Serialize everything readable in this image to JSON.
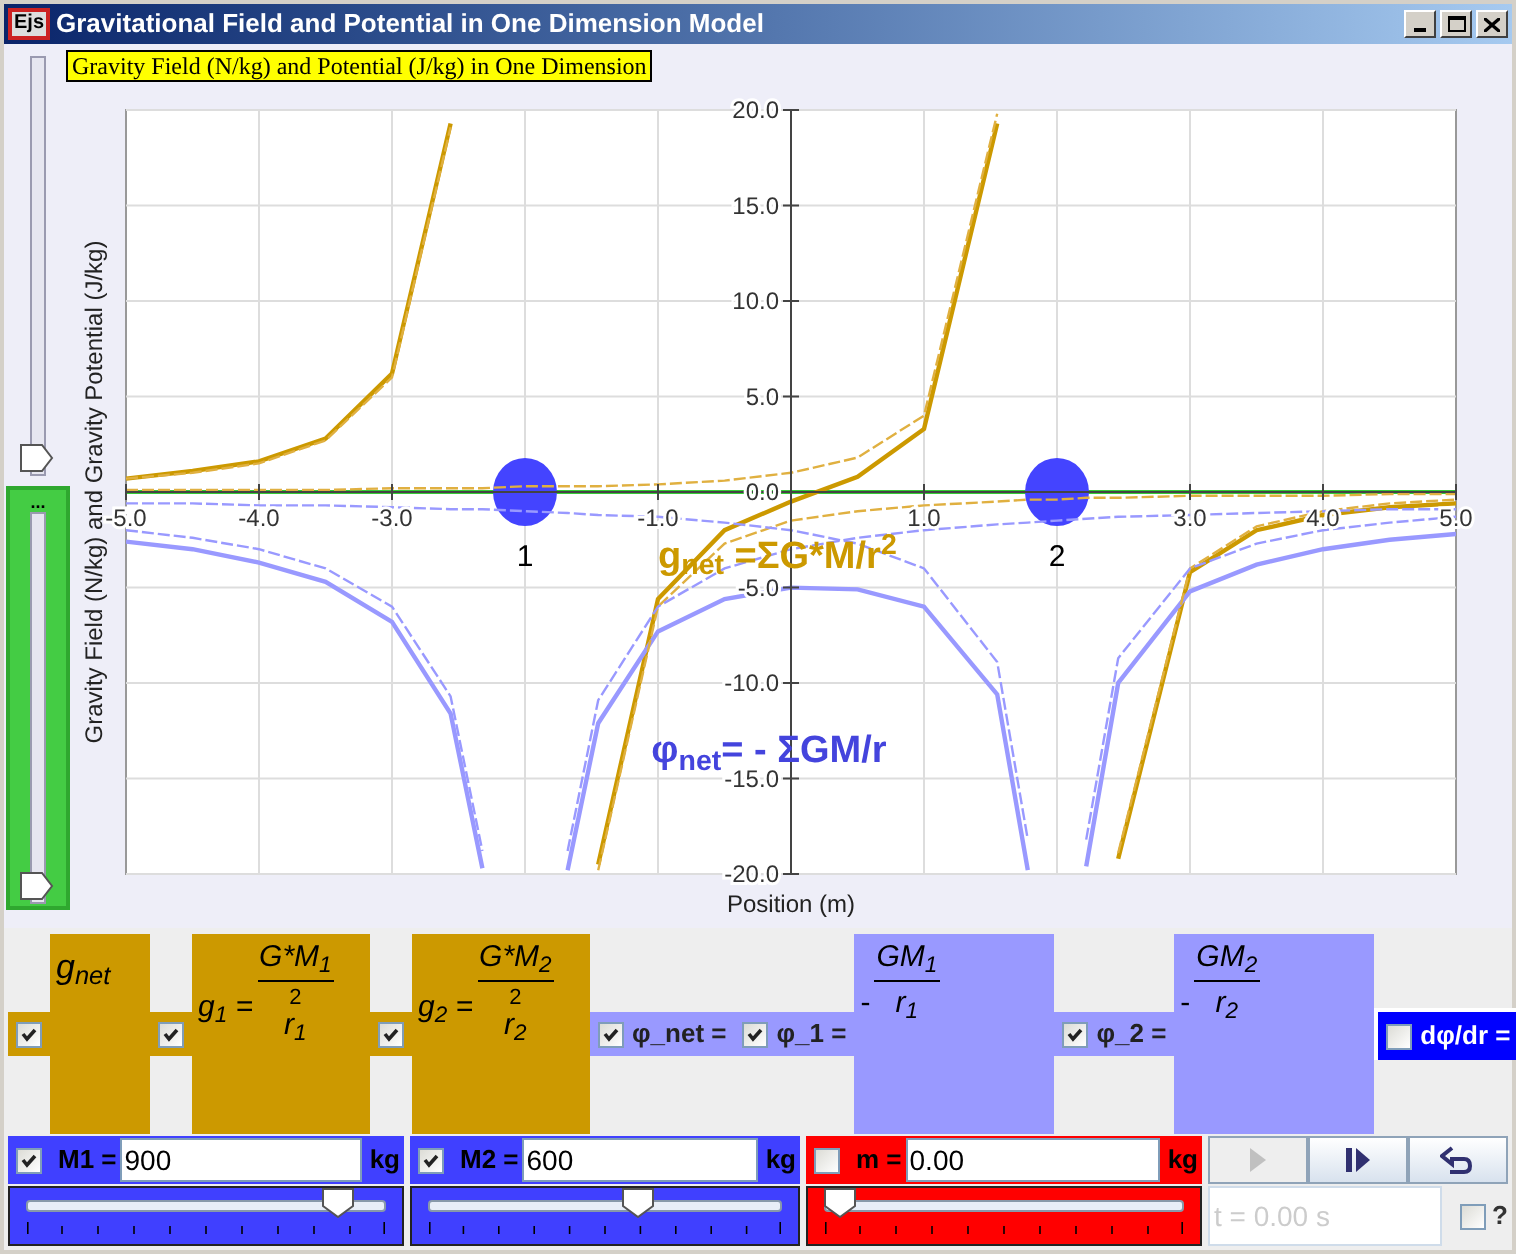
{
  "window": {
    "logo": "Ejs",
    "title": "Gravitational Field and Potential in One Dimension Model"
  },
  "left_sliders": [
    {
      "kind": "plain",
      "level": 0
    },
    {
      "kind": "green",
      "label": "...",
      "level": 0
    }
  ],
  "plot": {
    "title": "Gravity Field (N/kg) and Potential (J/kg) in One Dimension",
    "mass_markers": [
      {
        "label": "1"
      },
      {
        "label": "2"
      }
    ],
    "chart_data": {
      "type": "line",
      "xlabel": "Position (m)",
      "ylabel": "Gravity Field (N/kg) and Gravity Potential (J/kg)",
      "grid": true,
      "x": [
        -5,
        -4.5,
        -4,
        -3.5,
        -3,
        -2.56,
        -2.32,
        -2,
        -1.68,
        -1.45,
        -1,
        -0.5,
        0,
        0.5,
        1,
        1.55,
        1.78,
        2,
        2.22,
        2.46,
        3,
        3.5,
        4,
        4.5,
        5
      ],
      "series": [
        {
          "color": "#cc9900",
          "line_style": "solid",
          "values": [
            0.7,
            1.1,
            1.6,
            2.8,
            6.2,
            19.3,
            null,
            null,
            null,
            -19.5,
            -5.6,
            -2.0,
            -0.5,
            0.8,
            3.3,
            19.3,
            null,
            null,
            null,
            -19.2,
            -4.2,
            -2.0,
            -1.2,
            -0.8,
            -0.6
          ]
        },
        {
          "color": "#e0b040",
          "line_style": "dashed",
          "values": [
            0.7,
            1.0,
            1.5,
            2.7,
            6.0,
            19.1,
            null,
            null,
            null,
            -19.8,
            -6.0,
            -2.7,
            -1.5,
            -1.0,
            -0.7,
            -0.5,
            -0.4,
            -0.4,
            -0.3,
            -0.3,
            -0.2,
            -0.2,
            -0.2,
            -0.1,
            -0.1
          ]
        },
        {
          "color": "#e0b040",
          "line_style": "dashed",
          "values": [
            0.1,
            0.1,
            0.1,
            0.1,
            0.2,
            0.2,
            0.2,
            0.3,
            0.3,
            0.3,
            0.4,
            0.6,
            1.0,
            1.8,
            4.0,
            19.8,
            null,
            null,
            null,
            -18.9,
            -4.0,
            -1.8,
            -1.0,
            -0.6,
            -0.4
          ]
        },
        {
          "color": "#9999ff",
          "line_style": "solid",
          "values": [
            -2.6,
            -3.0,
            -3.7,
            -4.7,
            -6.8,
            -11.6,
            -19.7,
            null,
            -19.8,
            -12.1,
            -7.3,
            -5.6,
            -5.0,
            -5.1,
            -6.0,
            -10.6,
            -19.8,
            null,
            -19.6,
            -10.0,
            -5.2,
            -3.8,
            -3.0,
            -2.5,
            -2.2
          ]
        },
        {
          "color": "#9999ff",
          "line_style": "dashed",
          "values": [
            -2.0,
            -2.4,
            -3.0,
            -4.0,
            -6.0,
            -10.7,
            -18.8,
            null,
            -18.8,
            -10.9,
            -6.0,
            -4.0,
            -3.0,
            -2.4,
            -2.0,
            -1.7,
            -1.6,
            -1.5,
            -1.4,
            -1.3,
            -1.2,
            -1.1,
            -1.0,
            -0.9,
            -0.9
          ]
        },
        {
          "color": "#9999ff",
          "line_style": "dashed",
          "values": [
            -0.6,
            -0.6,
            -0.7,
            -0.7,
            -0.8,
            -0.9,
            -0.9,
            -1.0,
            -1.1,
            -1.2,
            -1.3,
            -1.6,
            -2.0,
            -2.7,
            -4.0,
            -8.9,
            -18.2,
            null,
            -18.2,
            -8.7,
            -4.0,
            -2.7,
            -2.0,
            -1.6,
            -1.3
          ]
        }
      ],
      "xlim": [
        -5,
        5
      ],
      "ylim": [
        -20,
        20
      ],
      "xticks": [
        {
          "value": -5,
          "label": "-5.0"
        },
        {
          "value": -4,
          "label": "-4.0"
        },
        {
          "value": -3,
          "label": "-3.0"
        },
        {
          "value": -1,
          "label": "-1.0"
        },
        {
          "value": 1,
          "label": "1.0"
        },
        {
          "value": 3,
          "label": "3.0"
        },
        {
          "value": 4,
          "label": "4.0"
        },
        {
          "value": 5,
          "label": "5.0"
        }
      ],
      "yticks": [
        {
          "value": 20,
          "label": "20.0"
        },
        {
          "value": 15,
          "label": "15.0"
        },
        {
          "value": 10,
          "label": "10.0"
        },
        {
          "value": 5,
          "label": "5.0"
        },
        {
          "value": 0,
          "label": "0.0"
        },
        {
          "value": -5,
          "label": "-5.0"
        },
        {
          "value": -10,
          "label": "-10.0"
        },
        {
          "value": -15,
          "label": "-15.0"
        },
        {
          "value": -20,
          "label": "-20.0"
        }
      ],
      "annotations": [
        "g$_{net}$ =ΣG*M/r$^{2}$",
        "φ$_{net}$= - ΣGM/r"
      ]
    }
  },
  "formulas": [
    {
      "kind": "field",
      "checked": true,
      "lhs": "g$_{net}$"
    },
    {
      "kind": "field",
      "checked": true,
      "lhs": "g$_{1}$ =",
      "numerator": "G*M$_{1}$",
      "power": "2",
      "denominator": "r$_{1}$"
    },
    {
      "kind": "field",
      "checked": true,
      "lhs": "g$_{2}$ =",
      "numerator": "G*M$_{2}$",
      "power": "2",
      "denominator": "r$_{2}$"
    },
    {
      "kind": "potential",
      "checked": true,
      "label": "φ_net ="
    },
    {
      "kind": "potential",
      "checked": true,
      "label": "φ_1 =",
      "sign": "-",
      "numerator": "GM$_{1}$",
      "denominator": "r$_{1}$"
    },
    {
      "kind": "potential",
      "checked": true,
      "label": "φ_2 =",
      "sign": "-",
      "numerator": "GM$_{2}$",
      "denominator": "r$_{2}$"
    },
    {
      "kind": "gradient",
      "checked": false,
      "label": "dφ/dr ="
    }
  ],
  "masses": [
    {
      "label": "M1 =",
      "checked": true,
      "value": "900",
      "unit": "kg",
      "level": 0.9,
      "color": "#4040ff"
    },
    {
      "label": "M2 =",
      "checked": true,
      "value": "600",
      "unit": "kg",
      "level": 0.6,
      "color": "#4040ff"
    },
    {
      "label": "m =",
      "checked": false,
      "value": "0.00",
      "unit": "kg",
      "level": 0,
      "color": "#ff0000"
    }
  ],
  "playback": [
    {
      "kind": "play",
      "disabled": true
    },
    {
      "kind": "step",
      "disabled": false
    },
    {
      "kind": "reset",
      "disabled": false
    }
  ],
  "time": {
    "placeholder": "t = 0.00 s"
  },
  "help": {
    "checked": false,
    "label": "?"
  }
}
